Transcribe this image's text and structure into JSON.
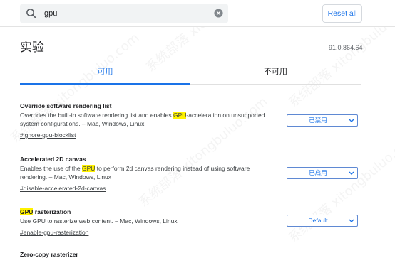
{
  "search": {
    "value": "gpu"
  },
  "reset_button": "Reset all",
  "page": {
    "title": "实验",
    "version": "91.0.864.64"
  },
  "tabs": [
    {
      "label": "可用"
    },
    {
      "label": "不可用"
    }
  ],
  "experiments": [
    {
      "title": "Override software rendering list",
      "desc_before": "Overrides the built-in software rendering list and enables ",
      "desc_highlight": "GPU",
      "desc_after": "-acceleration on unsupported system configurations. – Mac, Windows, Linux",
      "link": "#ignore-gpu-blocklist",
      "select_value": "已禁用"
    },
    {
      "title": "Accelerated 2D canvas",
      "desc_before": "Enables the use of the ",
      "desc_highlight": "GPU",
      "desc_after": " to perform 2d canvas rendering instead of using software rendering. – Mac, Windows, Linux",
      "link": "#disable-accelerated-2d-canvas",
      "select_value": "已启用"
    },
    {
      "title_highlight": "GPU",
      "title_after": " rasterization",
      "desc": "Use GPU to rasterize web content. – Mac, Windows, Linux",
      "link": "#enable-gpu-rasterization",
      "select_value": "Default"
    },
    {
      "title": "Zero-copy rasterizer"
    }
  ],
  "watermark": "系统部落 xitongbuluo.com",
  "colors": {
    "accent": "#1a73e8",
    "highlight": "#fff200"
  }
}
